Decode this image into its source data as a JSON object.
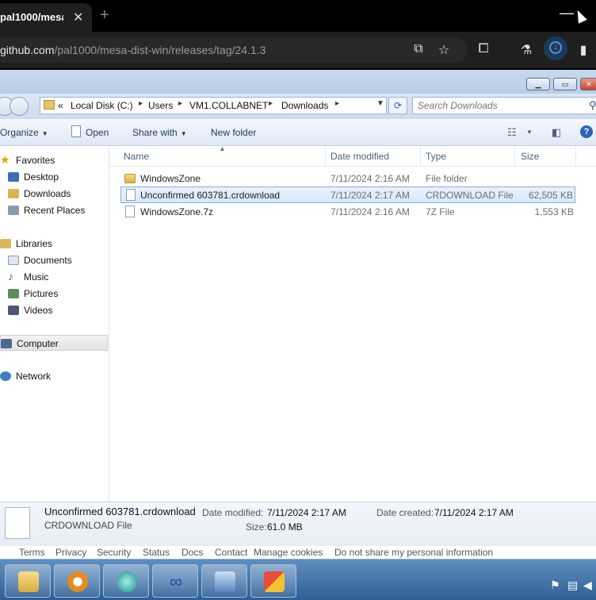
{
  "browser": {
    "tab_title": "pal1000/mesa",
    "tab_close": "✕",
    "new_tab": "+",
    "minimize": "—",
    "url_host": "github.com",
    "url_path": "/pal1000/mesa-dist-win/releases/tag/24.1.3"
  },
  "explorer": {
    "breadcrumb": {
      "prefix": "«",
      "items": [
        "Local Disk (C:)",
        "Users",
        "VM1.COLLABNET",
        "Downloads"
      ]
    },
    "search_placeholder": "Search Downloads",
    "commands": {
      "organize": "Organize",
      "open": "Open",
      "share_with": "Share with",
      "new_folder": "New folder"
    },
    "nav": {
      "favorites": "Favorites",
      "desktop": "Desktop",
      "downloads": "Downloads",
      "recent_places": "Recent Places",
      "libraries": "Libraries",
      "documents": "Documents",
      "music": "Music",
      "pictures": "Pictures",
      "videos": "Videos",
      "computer": "Computer",
      "network": "Network"
    },
    "columns": {
      "name": "Name",
      "date_modified": "Date modified",
      "type": "Type",
      "size": "Size"
    },
    "files": [
      {
        "name": "WindowsZone",
        "date": "7/11/2024 2:16 AM",
        "type": "File folder",
        "size": ""
      },
      {
        "name": "Unconfirmed 603781.crdownload",
        "date": "7/11/2024 2:17 AM",
        "type": "CRDOWNLOAD File",
        "size": "62,505 KB"
      },
      {
        "name": "WindowsZone.7z",
        "date": "7/11/2024 2:16 AM",
        "type": "7Z File",
        "size": "1,553 KB"
      }
    ],
    "details": {
      "name": "Unconfirmed 603781.crdownload",
      "type": "CRDOWNLOAD File",
      "date_modified_label": "Date modified:",
      "date_modified": "7/11/2024 2:17 AM",
      "date_created_label": "Date created:",
      "date_created": "7/11/2024 2:17 AM",
      "size_label": "Size:",
      "size": "61.0 MB"
    }
  },
  "footer_links": [
    "Terms",
    "Privacy",
    "Security",
    "Status",
    "Docs",
    "Contact",
    "Manage cookies",
    "Do not share my personal information"
  ]
}
